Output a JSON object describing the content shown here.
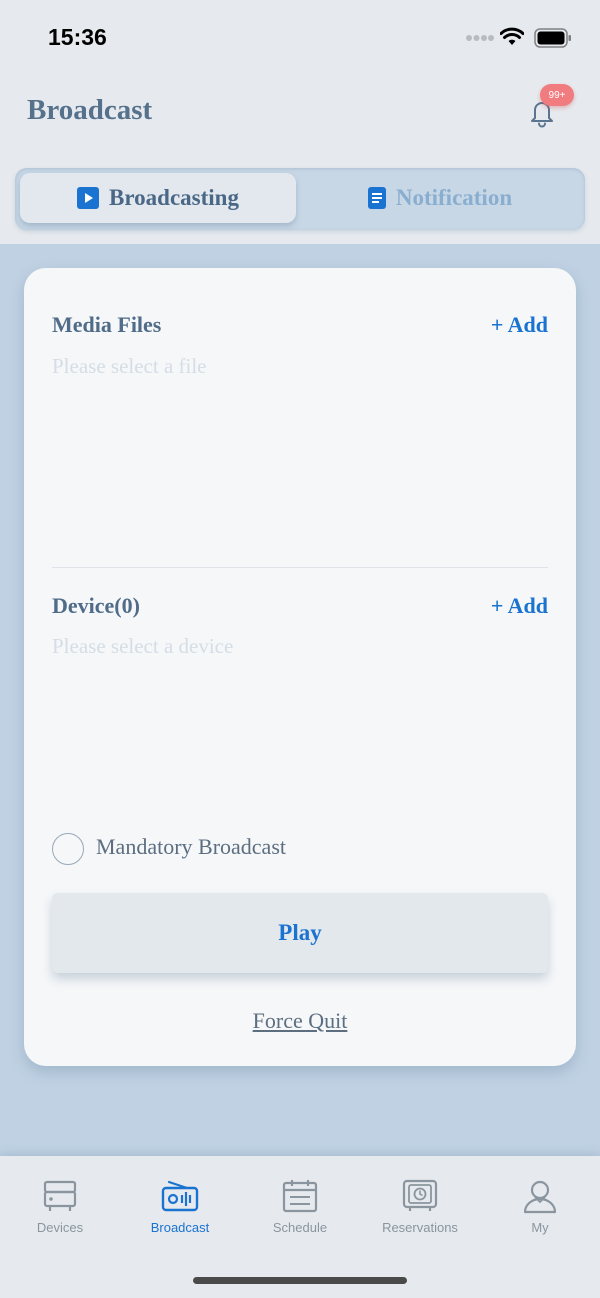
{
  "status_bar": {
    "time": "15:36"
  },
  "header": {
    "title": "Broadcast",
    "badge": "99+"
  },
  "tabs": [
    {
      "label": "Broadcasting",
      "icon": "play-square-icon",
      "active": true
    },
    {
      "label": "Notification",
      "icon": "document-icon",
      "active": false
    }
  ],
  "media": {
    "title": "Media Files",
    "add_label": "+ Add",
    "placeholder": "Please select a file"
  },
  "device": {
    "title": "Device(0)",
    "add_label": "+ Add",
    "placeholder": "Please select a device"
  },
  "mandatory": {
    "label": "Mandatory Broadcast",
    "checked": false
  },
  "actions": {
    "play_label": "Play",
    "force_quit_label": "Force Quit"
  },
  "nav": [
    {
      "label": "Devices",
      "icon": "device-icon",
      "active": false
    },
    {
      "label": "Broadcast",
      "icon": "radio-icon",
      "active": true
    },
    {
      "label": "Schedule",
      "icon": "calendar-icon",
      "active": false
    },
    {
      "label": "Reservations",
      "icon": "safe-clock-icon",
      "active": false
    },
    {
      "label": "My",
      "icon": "user-icon",
      "active": false
    }
  ],
  "colors": {
    "accent": "#1a73d0",
    "title": "#56718c",
    "background": "#bfd1e2",
    "badge": "#f07c80"
  }
}
